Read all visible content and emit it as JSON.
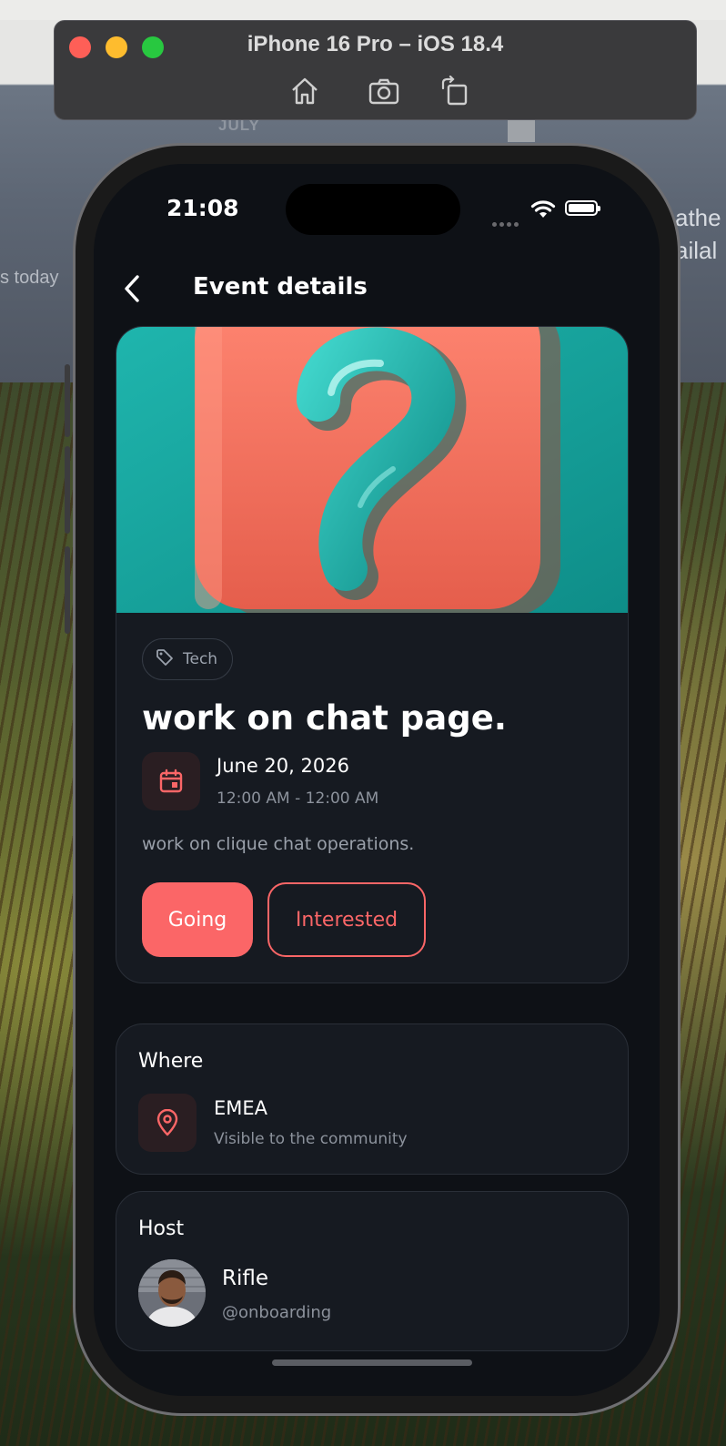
{
  "simulator": {
    "title": "iPhone 16 Pro – iOS 18.4",
    "tools": [
      "home-icon",
      "screenshot-icon",
      "rotate-icon"
    ]
  },
  "background": {
    "left_text": "s today",
    "month_text": "JULY",
    "right_text_1": "athe",
    "right_text_2": "ailal"
  },
  "status_bar": {
    "time": "21:08"
  },
  "nav": {
    "title": "Event details"
  },
  "event": {
    "tag": "Tech",
    "title": "work on chat page.",
    "date": "June 20, 2026",
    "time": "12:00 AM - 12:00 AM",
    "description": "work on clique chat operations.",
    "going_label": "Going",
    "interested_label": "Interested"
  },
  "where": {
    "heading": "Where",
    "title": "EMEA",
    "subtitle": "Visible to the community"
  },
  "host": {
    "heading": "Host",
    "name": "Rifle",
    "handle": "@onboarding"
  },
  "colors": {
    "accent": "#fb6667",
    "screen_bg": "#0e1116",
    "card_bg": "#161a21"
  }
}
